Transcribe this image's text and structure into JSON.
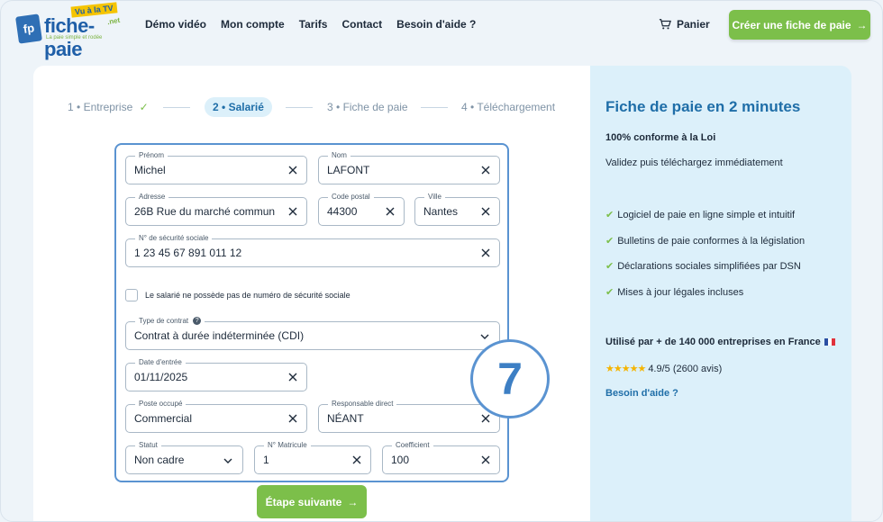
{
  "brand": {
    "word": "fiche-paie",
    "tv": "Vu à la TV",
    "net": ".net",
    "tagline": "La paie simple et rodée",
    "mark": "fp"
  },
  "nav": [
    "Démo vidéo",
    "Mon compte",
    "Tarifs",
    "Contact",
    "Besoin d'aide ?"
  ],
  "header": {
    "cart_label": "Panier",
    "cta_label": "Créer une fiche de paie"
  },
  "steps": [
    {
      "num": "1",
      "label": "Entreprise",
      "done": true
    },
    {
      "num": "2",
      "label": "Salarié",
      "active": true
    },
    {
      "num": "3",
      "label": "Fiche de paie"
    },
    {
      "num": "4",
      "label": "Téléchargement"
    }
  ],
  "form": {
    "prenom": {
      "label": "Prénom",
      "value": "Michel"
    },
    "nom": {
      "label": "Nom",
      "value": "LAFONT"
    },
    "adresse": {
      "label": "Adresse",
      "value": "26B Rue du marché commun"
    },
    "code_postal": {
      "label": "Code postal",
      "value": "44300"
    },
    "ville": {
      "label": "Ville",
      "value": "Nantes"
    },
    "secu": {
      "label": "N° de sécurité sociale",
      "value": "1 23 45 67 891 011 12"
    },
    "no_secu_checkbox": "Le salarié ne possède pas de numéro de sécurité sociale",
    "type_contrat": {
      "label": "Type de contrat",
      "value": "Contrat à durée indéterminée (CDI)"
    },
    "date_entree": {
      "label": "Date d'entrée",
      "value": "01/11/2025"
    },
    "poste": {
      "label": "Poste occupé",
      "value": "Commercial"
    },
    "responsable": {
      "label": "Responsable direct",
      "value": "NÉANT"
    },
    "statut": {
      "label": "Statut",
      "value": "Non cadre"
    },
    "matricule": {
      "label": "N° Matricule",
      "value": "1"
    },
    "coefficient": {
      "label": "Coefficient",
      "value": "100"
    }
  },
  "badge_number": "7",
  "next_label": "Étape suivante",
  "side": {
    "title": "Fiche de paie en 2 minutes",
    "sub1": "100% conforme à la Loi",
    "sub2": "Validez puis téléchargez immédiatement",
    "features": [
      "Logiciel de paie en ligne simple et intuitif",
      "Bulletins de paie conformes à la législation",
      "Déclarations sociales simplifiées par DSN",
      "Mises à jour légales incluses"
    ],
    "used_by": "Utilisé par + de 140 000 entreprises en France",
    "rating": "4.9/5 (2600 avis)",
    "help": "Besoin d'aide ?"
  },
  "colors": {
    "accent": "#7cbf4a",
    "brand_blue": "#1f6ea8",
    "form_border": "#5a93d1",
    "side_bg": "#dcf0fa"
  }
}
